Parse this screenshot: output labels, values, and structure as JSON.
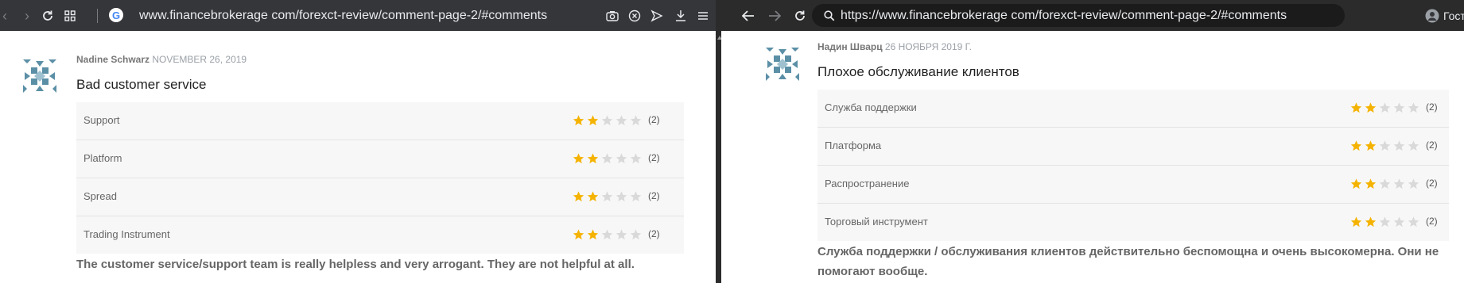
{
  "left": {
    "address": "www.financebrokerage com/forexct-review/comment-page-2/#comments",
    "author": "Nadine Schwarz",
    "date": "NOVEMBER 26, 2019",
    "title": "Bad customer service",
    "ratings": [
      {
        "label": "Support",
        "stars": 2,
        "max": 5,
        "count": "(2)"
      },
      {
        "label": "Platform",
        "stars": 2,
        "max": 5,
        "count": "(2)"
      },
      {
        "label": "Spread",
        "stars": 2,
        "max": 5,
        "count": "(2)"
      },
      {
        "label": "Trading Instrument",
        "stars": 2,
        "max": 5,
        "count": "(2)"
      }
    ],
    "review": "The customer service/support team is really helpless and very arrogant. They are not helpful at all.",
    "icons": [
      "back-icon",
      "forward-icon",
      "reload-icon",
      "apps-grid-icon",
      "google-icon",
      "camera-icon",
      "close-circle-icon",
      "send-icon",
      "download-icon",
      "menu-icon"
    ]
  },
  "right": {
    "address": "https://www.financebrokerage com/forexct-review/comment-page-2/#comments",
    "profile_label": "Гость",
    "author": "Надин Шварц",
    "date": "26 НОЯБРЯ 2019 Г.",
    "title": "Плохое обслуживание клиентов",
    "ratings": [
      {
        "label": "Служба поддержки",
        "stars": 2,
        "max": 5,
        "count": "(2)"
      },
      {
        "label": "Платформа",
        "stars": 2,
        "max": 5,
        "count": "(2)"
      },
      {
        "label": "Распространение",
        "stars": 2,
        "max": 5,
        "count": "(2)"
      },
      {
        "label": "Торговый инструмент",
        "stars": 2,
        "max": 5,
        "count": "(2)"
      }
    ],
    "review": "Служба поддержки / обслуживания клиентов действительно беспомощна и очень высокомерна. Они не помогают вообще.",
    "icons": [
      "back-icon",
      "forward-icon",
      "reload-icon",
      "search-icon",
      "profile-icon"
    ]
  },
  "colors": {
    "star_filled": "#f5b301",
    "star_empty": "#d9d9d9",
    "toolbar": "#35363a",
    "address_bg": "#202124"
  }
}
